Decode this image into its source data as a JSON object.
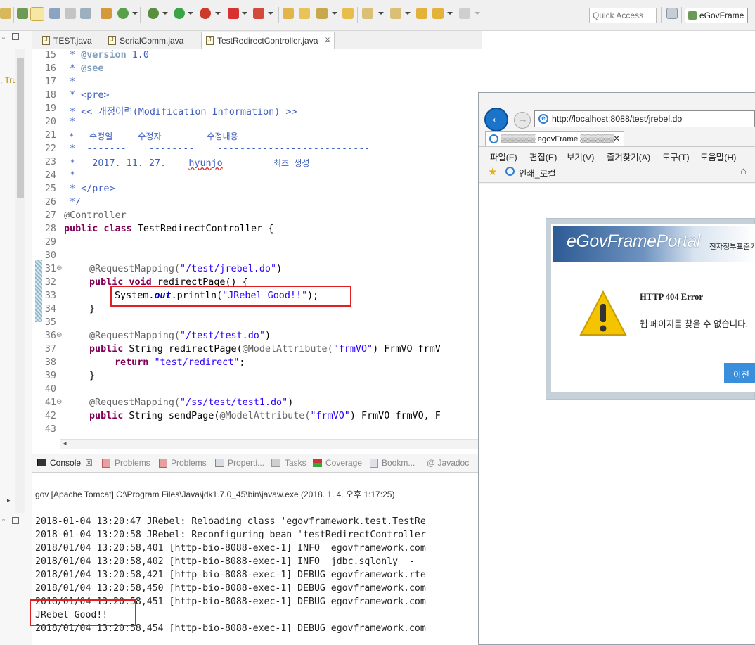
{
  "toolbar": {
    "quick_access_placeholder": "Quick Access",
    "perspective_label": "eGovFrame"
  },
  "editor_tabs": [
    {
      "label": "TEST.java"
    },
    {
      "label": "SerialComm.java"
    },
    {
      "label": "TestRedirectController.java",
      "close": "☒"
    }
  ],
  "left_strip": {
    "text": ", Tru"
  },
  "code": {
    "lines": [
      {
        "num": "15"
      },
      {
        "num": "16"
      },
      {
        "num": "17"
      },
      {
        "num": "18"
      },
      {
        "num": "19"
      },
      {
        "num": "20"
      },
      {
        "num": "21"
      },
      {
        "num": "22"
      },
      {
        "num": "23"
      },
      {
        "num": "24"
      },
      {
        "num": "25"
      },
      {
        "num": "26"
      },
      {
        "num": "27"
      },
      {
        "num": "28"
      },
      {
        "num": "29"
      },
      {
        "num": "30"
      },
      {
        "num": "31"
      },
      {
        "num": "32"
      },
      {
        "num": "33"
      },
      {
        "num": "34"
      },
      {
        "num": "35"
      },
      {
        "num": "36"
      },
      {
        "num": "37"
      },
      {
        "num": "38"
      },
      {
        "num": "39"
      },
      {
        "num": "40"
      },
      {
        "num": "41"
      },
      {
        "num": "42"
      },
      {
        "num": "43"
      }
    ],
    "l15_star": " * ",
    "l15_tag": "@version",
    "l15_rest": " 1.0",
    "l16_star": " * ",
    "l16_tag": "@see",
    "l17": " *",
    "l18": " * <pre>",
    "l19": " * << 개정이력(Modification Information) >>",
    "l20": " *",
    "l21": " *   수정일     수정자         수정내용",
    "l22": " *  -------    --------    ---------------------------",
    "l23a": " *   2017. 11. 27.    ",
    "l23b": "hyunjo",
    "l23c": "          최초 생성",
    "l24": " *",
    "l25": " * </pre>",
    "l26": " */",
    "l27": "@Controller",
    "l28_kw": "public class",
    "l28_rest": " TestRedirectController {",
    "l31_ann": "@RequestMapping(",
    "l31_str": "\"/test/jrebel.do\"",
    "l31_end": ")",
    "l32_kw": "public void",
    "l32_rest": " redirectPage() {",
    "l33_a": "System.",
    "l33_fld": "out",
    "l33_b": ".println(",
    "l33_str": "\"JRebel Good!!\"",
    "l33_c": ");",
    "l34": "}",
    "l36_ann": "@RequestMapping(",
    "l36_str": "\"/test/test.do\"",
    "l36_end": ")",
    "l37_kw": "public",
    "l37_a": " String redirectPage(",
    "l37_ann": "@ModelAttribute(",
    "l37_str": "\"frmVO\"",
    "l37_b": ") FrmVO frmV",
    "l38_kw": "return",
    "l38_str": "\"test/redirect\"",
    "l38_end": ";",
    "l39": "}",
    "l41_ann": "@RequestMapping(",
    "l41_str": "\"/ss/test/test1.do\"",
    "l41_end": ")",
    "l42_kw": "public",
    "l42_a": " String sendPage(",
    "l42_ann": "@ModelAttribute(",
    "l42_str": "\"frmVO\"",
    "l42_b": ") FrmVO frmVO, F"
  },
  "console_tabs": {
    "console": "Console",
    "console_close": "☒",
    "problems1": "Problems",
    "problems2": "Problems",
    "properties": "Properti...",
    "tasks": "Tasks",
    "coverage": "Coverage",
    "bookmarks": "Bookm...",
    "javadoc": "@ Javadoc"
  },
  "console": {
    "path": "gov [Apache Tomcat] C:\\Program Files\\Java\\jdk1.7.0_45\\bin\\javaw.exe (2018. 1. 4. 오후 1:17:25)",
    "lines": [
      "2018-01-04 13:20:47 JRebel: Reloading class 'egovframework.test.TestRe",
      "2018-01-04 13:20:58 JRebel: Reconfiguring bean 'testRedirectController",
      "2018/01/04 13:20:58,401 [http-bio-8088-exec-1] INFO  egovframework.com",
      "2018/01/04 13:20:58,402 [http-bio-8088-exec-1] INFO  jdbc.sqlonly  -",
      "2018/01/04 13:20:58,421 [http-bio-8088-exec-1] DEBUG egovframework.rte",
      "2018/01/04 13:20:58,450 [http-bio-8088-exec-1] DEBUG egovframework.com",
      "2018/01/04 13:20:58,451 [http-bio-8088-exec-1] DEBUG egovframework.com",
      "JRebel Good!!",
      "2018/01/04 13:20:58,454 [http-bio-8088-exec-1] DEBUG egovframework.com"
    ]
  },
  "browser": {
    "url": "http://localhost:8088/test/jrebel.do",
    "tab_title": "▒▒▒▒▒▒ egovFrame ▒▒▒▒▒▒",
    "tab_close": "✕",
    "menu": [
      "파일(F)",
      "편집(E)",
      "보기(V)",
      "즐겨찾기(A)",
      "도구(T)",
      "도움말(H)"
    ],
    "favorite": "인쇄_로컬",
    "logo": "eGovFramePortal",
    "logo_sub": "전자정부표준기",
    "error_title": "HTTP 404 Error",
    "error_message": "웹 페이지를 찾을 수 없습니다.",
    "prev_button": "이전"
  },
  "colors": {
    "highlight_box": "#e02020",
    "ie_blue": "#1a74c9"
  }
}
